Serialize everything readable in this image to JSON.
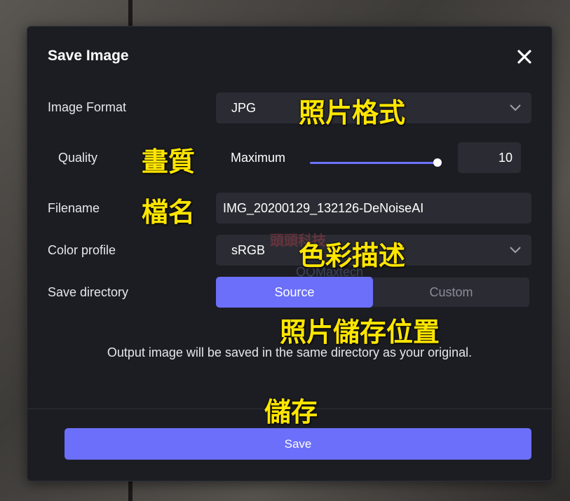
{
  "dialog": {
    "title": "Save Image",
    "close_icon": "close-icon"
  },
  "form": {
    "image_format": {
      "label": "Image Format",
      "value": "JPG"
    },
    "quality": {
      "label": "Quality",
      "level_label": "Maximum",
      "value": "10",
      "slider_fraction": 1.0
    },
    "filename": {
      "label": "Filename",
      "value": "IMG_20200129_132126-DeNoiseAI"
    },
    "color_profile": {
      "label": "Color profile",
      "value": "sRGB"
    },
    "save_directory": {
      "label": "Save directory",
      "options": [
        "Source",
        "Custom"
      ],
      "selected": "Source"
    }
  },
  "note": "Output image will be saved in the same directory as your original.",
  "save_label": "Save",
  "annotations": {
    "format": "照片格式",
    "quality": "畫質",
    "filename": "檔名",
    "profile": "色彩描述",
    "directory": "照片儲存位置",
    "save": "儲存"
  },
  "watermark": {
    "line1": "頭頭科技",
    "line2": "QQMaxtech"
  },
  "colors": {
    "accent": "#6b6ff9",
    "dialog_bg": "#1c1d23",
    "field_bg": "#2b2c33",
    "annotation": "#ffe600"
  }
}
